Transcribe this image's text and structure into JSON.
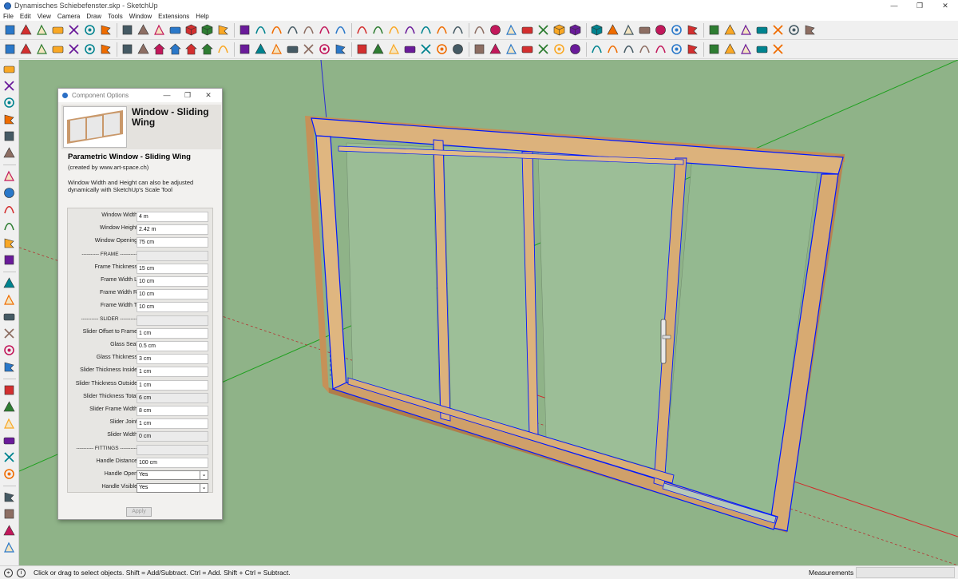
{
  "window": {
    "title": "Dynamisches Schiebefenster.skp - SketchUp",
    "controls": {
      "minimize": "—",
      "maximize": "❐",
      "close": "✕"
    }
  },
  "menu": [
    "File",
    "Edit",
    "View",
    "Camera",
    "Draw",
    "Tools",
    "Window",
    "Extensions",
    "Help"
  ],
  "toolbar1_icons": [
    "select-icon",
    "eraser-icon",
    "paint-bucket-icon",
    "tag-icon",
    "walk-icon",
    "push-pull-icon",
    "layout-icon",
    "warehouse-icon",
    "extension-icon",
    "ruby-icon",
    "tape-icon",
    "solid-icon",
    "box-icon",
    "reload-icon",
    "folder-icon",
    "curve-1-icon",
    "curve-2-icon",
    "curve-3-icon",
    "curve-4-icon",
    "curve-5-icon",
    "arc-1-icon",
    "arc-2-icon",
    "spiral-icon",
    "arc-3-icon",
    "curve-6-icon",
    "arc-4-icon",
    "arc-5-icon",
    "arc-6-icon",
    "bezier-icon",
    "circle-icon",
    "polyline-icon",
    "rounded-icon",
    "shape-icon",
    "cube-red-icon",
    "cube-blue-icon",
    "cube-grey-icon",
    "scenes-icon",
    "layer-manager-icon",
    "forward-icon",
    "compass-icon",
    "pen-icon",
    "section-icon",
    "light-icon",
    "star-icon",
    "gear-red-icon",
    "list-icon",
    "map-icon",
    "color-icon",
    "arrow-icon"
  ],
  "toolbar2_icons": [
    "sandbox-1-icon",
    "sandbox-2-icon",
    "sandbox-3-icon",
    "sandbox-4-icon",
    "sandbox-5-icon",
    "sandbox-6-icon",
    "xyz-icon",
    "pencil-icon",
    "pins-icon",
    "house-yellow-icon",
    "house-green-icon",
    "house-blue-icon",
    "house-purple-icon",
    "spiral-red-icon",
    "view-1-icon",
    "view-2-icon",
    "view-3-icon",
    "view-4-icon",
    "view-5-icon",
    "view-6-icon",
    "view-7-icon",
    "zoom-1-icon",
    "zoom-2-icon",
    "zoom-3-icon",
    "measure-icon",
    "refresh-icon",
    "orange-icon",
    "plus-circle-icon",
    "tree-icon",
    "pie-icon",
    "checker-icon",
    "cloud-icon",
    "settings-icon",
    "mail-icon",
    "info-icon",
    "curve-a-icon",
    "curve-b-icon",
    "curve-c-icon",
    "curve-d-icon",
    "curve-e-icon",
    "dim-1-icon",
    "dim-2-icon",
    "dim-3-icon",
    "dim-4-icon",
    "dim-5-icon",
    "dim-6-icon",
    "dim-7-icon"
  ],
  "left_tools": [
    "select-tool-icon",
    "eraser-tool-icon",
    "tag-tool-icon",
    "move-tool-icon",
    "user-tool-icon",
    "freehand-tool-icon",
    "rectangle-tool-icon",
    "circle-tool-icon",
    "arc-tool-icon",
    "arc2-tool-icon",
    "offset-tool-icon",
    "pie-tool-icon",
    "rotate-tool-icon",
    "scale-tool-icon",
    "zoom-tool-icon",
    "tape-tool-icon",
    "walk-tool-icon",
    "footprints-tool-icon",
    "orbit-tool-icon",
    "pan-tool-icon",
    "zoom-window-tool-icon",
    "zoom-extents-tool-icon",
    "style-1-icon",
    "style-2-icon",
    "style-3-icon",
    "style-4-icon",
    "style-5-icon",
    "record-icon"
  ],
  "colors": {
    "viewport": "#8fb388",
    "wood": "#dcb27c",
    "wood_dark": "#c58f57",
    "selection": "#0018ff",
    "axis_red": "#d02a2a",
    "axis_green": "#1fa01f",
    "axis_blue": "#2b2bd4"
  },
  "dialog": {
    "title": "Component Options",
    "component_name": "Window - Sliding Wing",
    "heading": "Parametric Window - Sliding Wing",
    "credit": "(created by www.art-space.ch)",
    "description": "Window Width and Height can also be adjusted dynamically with SketchUp's Scale Tool",
    "options": [
      {
        "label": "Window Width",
        "value": "4 m"
      },
      {
        "label": "Window Height",
        "value": "2.42 m"
      },
      {
        "label": "Window Opening",
        "value": "75 cm"
      },
      {
        "label": "---------- FRAME ----------",
        "value": ""
      },
      {
        "label": "Frame Thickness",
        "value": "15 cm"
      },
      {
        "label": "Frame Width L",
        "value": "10 cm"
      },
      {
        "label": "Frame Width R",
        "value": "10 cm"
      },
      {
        "label": "Frame Width T",
        "value": "10 cm"
      },
      {
        "label": "---------- SLIDER ----------",
        "value": ""
      },
      {
        "label": "Slider Offset to Frame",
        "value": "1 cm"
      },
      {
        "label": "Glass Seal",
        "value": "0.5 cm"
      },
      {
        "label": "Glass Thickness",
        "value": "3 cm"
      },
      {
        "label": "Slider Thickness Inside",
        "value": "1 cm"
      },
      {
        "label": "Slider Thickness Outside",
        "value": "1 cm"
      },
      {
        "label": "Slider Thickness Total",
        "value": "6 cm"
      },
      {
        "label": "Slider Frame Width",
        "value": "8 cm"
      },
      {
        "label": "Slider Joint",
        "value": "1 cm"
      },
      {
        "label": "Slider Width",
        "value": "0 cm"
      },
      {
        "label": "---------- FITTINGS ----------",
        "value": ""
      },
      {
        "label": "Handle Distance",
        "value": "100 cm"
      },
      {
        "label": "Handle Open",
        "value": "Yes"
      },
      {
        "label": "Handle Visible",
        "value": "Yes"
      }
    ],
    "apply_label": "Apply"
  },
  "statusbar": {
    "hint": "Click or drag to select objects. Shift = Add/Subtract. Ctrl = Add. Shift + Ctrl = Subtract.",
    "measurements_label": "Measurements",
    "measurements_value": ""
  }
}
